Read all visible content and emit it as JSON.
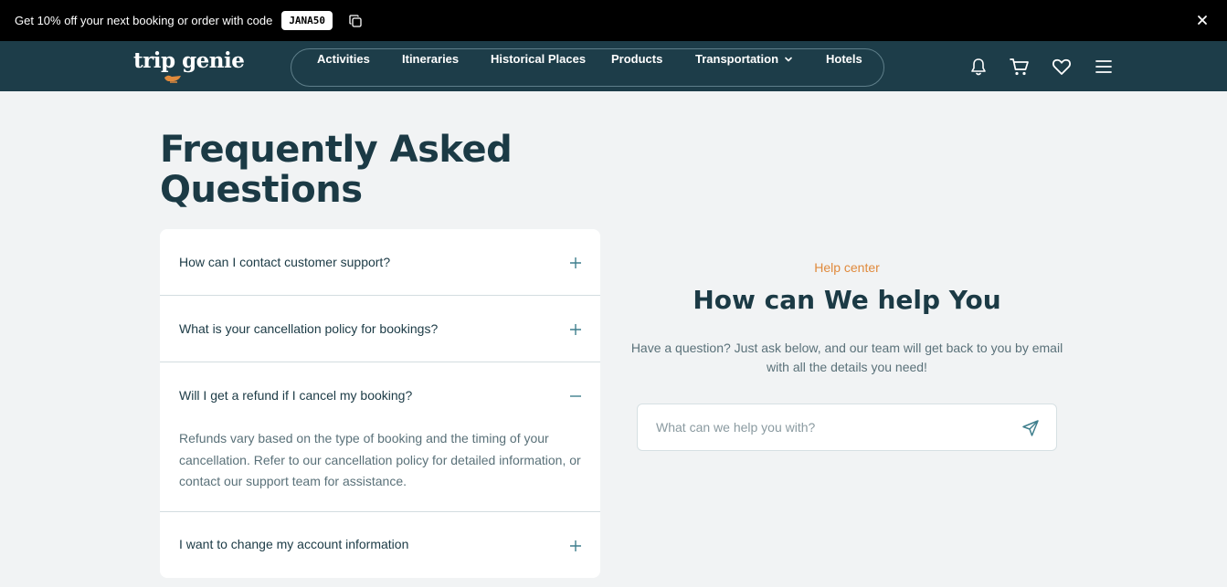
{
  "promo": {
    "text": "Get 10% off your next booking or order with code",
    "code": "JANA50"
  },
  "brand": {
    "name": "trip genie",
    "accent": "#e08a3c",
    "nav_bg": "#1d3d49"
  },
  "nav": {
    "items": [
      {
        "label": "Activities"
      },
      {
        "label": "Itineraries"
      },
      {
        "label": "Historical Places"
      },
      {
        "label": "Products"
      },
      {
        "label": "Transportation",
        "has_dropdown": true
      },
      {
        "label": "Hotels"
      }
    ],
    "icons": [
      "bell-icon",
      "cart-icon",
      "heart-icon",
      "menu-icon"
    ]
  },
  "faq": {
    "title": "Frequently Asked Questions",
    "items": [
      {
        "question": "How can I contact customer support?",
        "expanded": false
      },
      {
        "question": "What is your cancellation policy for bookings?",
        "expanded": false
      },
      {
        "question": "Will I get a refund if I cancel my booking?",
        "expanded": true,
        "answer": "Refunds vary based on the type of booking and the timing of your cancellation. Refer to our cancellation policy for detailed information, or contact our support team for assistance."
      },
      {
        "question": "I want to change my account information",
        "expanded": false
      }
    ]
  },
  "help": {
    "kicker": "Help center",
    "title": "How can We help You",
    "description": "Have a question? Just ask below, and our team will get back to you by email with all the details you need!",
    "input_value": "",
    "input_placeholder": "What can we help you with?"
  }
}
